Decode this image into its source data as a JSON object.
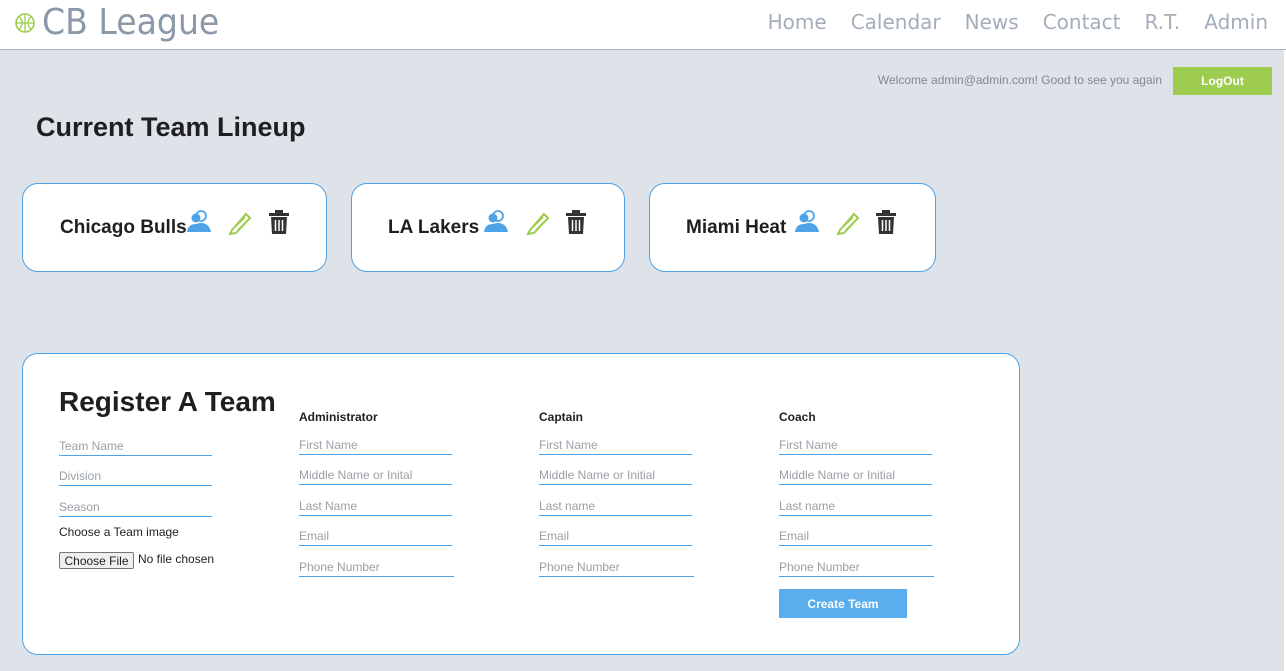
{
  "brand": {
    "name": "CB League",
    "icon": "basketball-icon"
  },
  "nav": [
    "Home",
    "Calendar",
    "News",
    "Contact",
    "R.T.",
    "Admin"
  ],
  "welcome_text": "Welcome admin@admin.com! Good to see you again",
  "logout_label": "LogOut",
  "lineup": {
    "title": "Current Team Lineup",
    "teams": [
      "Chicago Bulls",
      "LA Lakers",
      "Miami Heat"
    ],
    "actions": [
      "roster-icon",
      "edit-icon",
      "delete-icon"
    ]
  },
  "register": {
    "title": "Register A Team",
    "team_fields": [
      "Team Name",
      "Division",
      "Season"
    ],
    "image_label": "Choose a Team image",
    "file_button": "Choose File",
    "file_status": "No file chosen",
    "columns": [
      {
        "heading": "Administrator",
        "fields": [
          "First Name",
          "Middle Name or Inital",
          "Last Name",
          "Email",
          "Phone Number"
        ]
      },
      {
        "heading": "Captain",
        "fields": [
          "First Name",
          "Middle Name or Initial",
          "Last name",
          "Email",
          "Phone Number"
        ]
      },
      {
        "heading": "Coach",
        "fields": [
          "First Name",
          "Middle Name or Initial",
          "Last name",
          "Email",
          "Phone Number"
        ]
      }
    ],
    "submit_label": "Create Team"
  },
  "colors": {
    "accent_green": "#9dcc4e",
    "accent_blue": "#4ea3e6",
    "background": "#dde3e8"
  }
}
